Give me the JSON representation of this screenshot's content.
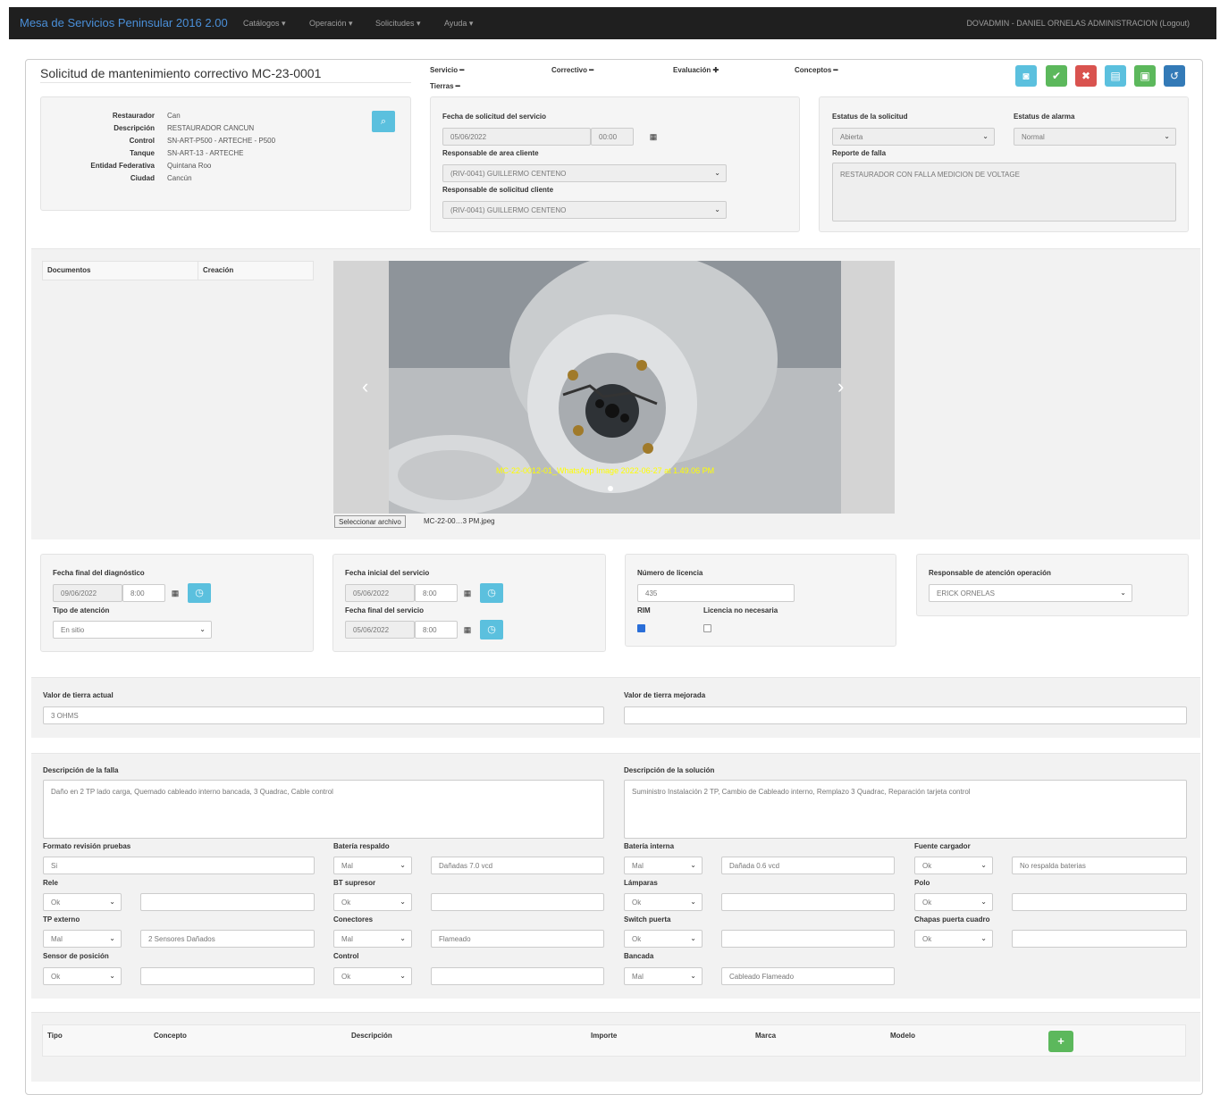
{
  "navbar": {
    "brand": "Mesa de Servicios Peninsular 2016 2.00",
    "menu": [
      "Catálogos ▾",
      "Operación ▾",
      "Solicitudes ▾",
      "Ayuda ▾"
    ],
    "user": "DOVADMIN - DANIEL ORNELAS ADMINISTRACION (Logout)"
  },
  "header": {
    "title": "Solicitud de mantenimiento correctivo MC-23-0001",
    "tabs": [
      "Servicio ━",
      "Correctivo ━",
      "Evaluación ✚",
      "Conceptos ━",
      "Tierras ━"
    ]
  },
  "toolbar": {
    "colors": {
      "info": "#5bc0de",
      "success": "#5cb85c",
      "danger": "#d9534f",
      "primary": "#337ab7"
    },
    "icons": [
      "camera-icon",
      "check-icon",
      "close-icon",
      "report-icon",
      "save-icon",
      "undo-icon"
    ]
  },
  "restaurador": {
    "labels": [
      "Restaurador",
      "Descripción",
      "Control",
      "Tanque",
      "Entidad Federativa",
      "Ciudad"
    ],
    "values": [
      "Can",
      "RESTAURADOR CANCUN",
      "SN-ART-P500 - ARTECHE - P500",
      "SN-ART-13 - ARTECHE",
      "Quintana Roo",
      "Cancún"
    ]
  },
  "solicitud": {
    "fecha_label": "Fecha de solicitud del servicio",
    "fecha": "05/06/2022",
    "hora": "00:00",
    "resp_area_label": "Responsable de area cliente",
    "resp_area": "(RIV-0041) GUILLERMO CENTENO",
    "resp_sol_label": "Responsable de solicitud cliente",
    "resp_sol": "(RIV-0041) GUILLERMO CENTENO"
  },
  "estatus": {
    "sol_label": "Estatus de la solicitud",
    "sol": "Abierta",
    "alarma_label": "Estatus de alarma",
    "alarma": "Normal",
    "falla_label": "Reporte de falla",
    "falla": "RESTAURADOR CON FALLA MEDICION DE VOLTAGE"
  },
  "documents": {
    "col1": "Documentos",
    "col2": "Creación",
    "file_button": "Seleccionar archivo",
    "file_name": "MC-22-00…3 PM.jpeg",
    "caption": "MC-22-0012-01_WhatsApp Image 2022-06-27 at 1.49.06 PM"
  },
  "diag": {
    "fecha_label": "Fecha final del diagnóstico",
    "fecha": "09/06/2022",
    "hora": "8:00",
    "tipo_label": "Tipo de atención",
    "tipo": "En sitio"
  },
  "servicio": {
    "ini_label": "Fecha inicial del servicio",
    "ini_fecha": "05/06/2022",
    "ini_hora": "8:00",
    "fin_label": "Fecha final del servicio",
    "fin_fecha": "05/06/2022",
    "fin_hora": "8:00"
  },
  "licencia": {
    "num_label": "Número de licencia",
    "num": "435",
    "rim_label": "RIM",
    "no_nec_label": "Licencia no necesaria"
  },
  "responsable": {
    "label": "Responsable de atención operación",
    "value": "ERICK ORNELAS"
  },
  "tierra": {
    "actual_label": "Valor de tierra actual",
    "actual": "3 OHMS",
    "mejorada_label": "Valor de tierra mejorada",
    "mejorada": ""
  },
  "descripciones": {
    "falla_label": "Descripción de la falla",
    "falla": "Daño en 2 TP lado carga, Quemado cableado interno bancada, 3 Quadrac, Cable control",
    "solucion_label": "Descripción de la solución",
    "solucion": "Suministro Instalación 2 TP, Cambio de Cableado interno, Remplazo 3 Quadrac, Reparación tarjeta control"
  },
  "revision": {
    "formato_label": "Formato revisión pruebas",
    "formato": "Si",
    "bateria_resp_label": "Batería respaldo",
    "bateria_resp": "Mal",
    "bateria_resp_obs": "Dañadas 7.0 vcd",
    "bateria_int_label": "Batería interna",
    "bateria_int": "Mal",
    "bateria_int_obs": "Dañada 0.6 vcd",
    "fuente_label": "Fuente cargador",
    "fuente": "Ok",
    "fuente_obs": "No respalda baterias",
    "rele_label": "Rele",
    "rele": "Ok",
    "rele_obs": "",
    "bt_label": "BT supresor",
    "bt": "Ok",
    "bt_obs": "",
    "lamparas_label": "Lámparas",
    "lamparas": "Ok",
    "lamparas_obs": "",
    "polo_label": "Polo",
    "polo": "Ok",
    "polo_obs": "",
    "tp_label": "TP externo",
    "tp": "Mal",
    "tp_obs": "2 Sensores Dañados",
    "conectores_label": "Conectores",
    "conectores": "Mal",
    "conectores_obs": "Flameado",
    "switch_label": "Switch puerta",
    "switch": "Ok",
    "switch_obs": "",
    "chapas_label": "Chapas puerta cuadro",
    "chapas": "Ok",
    "chapas_obs": "",
    "sensor_label": "Sensor de posición",
    "sensor": "Ok",
    "sensor_obs": "",
    "control_label": "Control",
    "control": "Ok",
    "control_obs": "",
    "bancada_label": "Bancada",
    "bancada": "Mal",
    "bancada_obs": "Cableado Flameado"
  },
  "conceptos": {
    "headers": [
      "Tipo",
      "Concepto",
      "Descripción",
      "Importe",
      "Marca",
      "Modelo"
    ]
  }
}
